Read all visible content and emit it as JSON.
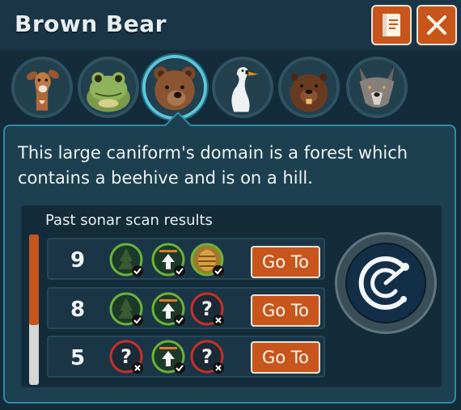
{
  "window": {
    "title": "Brown Bear",
    "buttons": {
      "guide_icon": "book-icon",
      "close_icon": "close-icon"
    }
  },
  "portraits": [
    {
      "animal": "Deer",
      "active": false
    },
    {
      "animal": "Frog",
      "active": false
    },
    {
      "animal": "Brown Bear",
      "active": true
    },
    {
      "animal": "Swan",
      "active": false
    },
    {
      "animal": "Beaver",
      "active": false
    },
    {
      "animal": "Wolf",
      "active": false
    }
  ],
  "clue": {
    "text": "This large caniform's domain is a forest which contains a beehive and is on a hill."
  },
  "scan_results": {
    "heading": "Past sonar scan results",
    "go_label": "Go To",
    "rows": [
      {
        "number": "9",
        "checks": [
          {
            "icon": "forest-icon",
            "result": "match"
          },
          {
            "icon": "hill-icon",
            "result": "match"
          },
          {
            "icon": "beehive-icon",
            "result": "match"
          }
        ]
      },
      {
        "number": "8",
        "checks": [
          {
            "icon": "forest-icon",
            "result": "match"
          },
          {
            "icon": "hill-icon",
            "result": "match"
          },
          {
            "icon": "unknown-icon",
            "result": "miss"
          }
        ]
      },
      {
        "number": "5",
        "checks": [
          {
            "icon": "unknown-icon",
            "result": "miss"
          },
          {
            "icon": "hill-icon",
            "result": "match"
          },
          {
            "icon": "unknown-icon",
            "result": "miss"
          }
        ]
      }
    ]
  },
  "sonar_button": {
    "icon": "sonar-icon"
  },
  "colors": {
    "accent_orange": "#c8561c",
    "active_cyan": "#5fc4d8",
    "match_green": "#6ab23a",
    "miss_red": "#c8302a"
  }
}
